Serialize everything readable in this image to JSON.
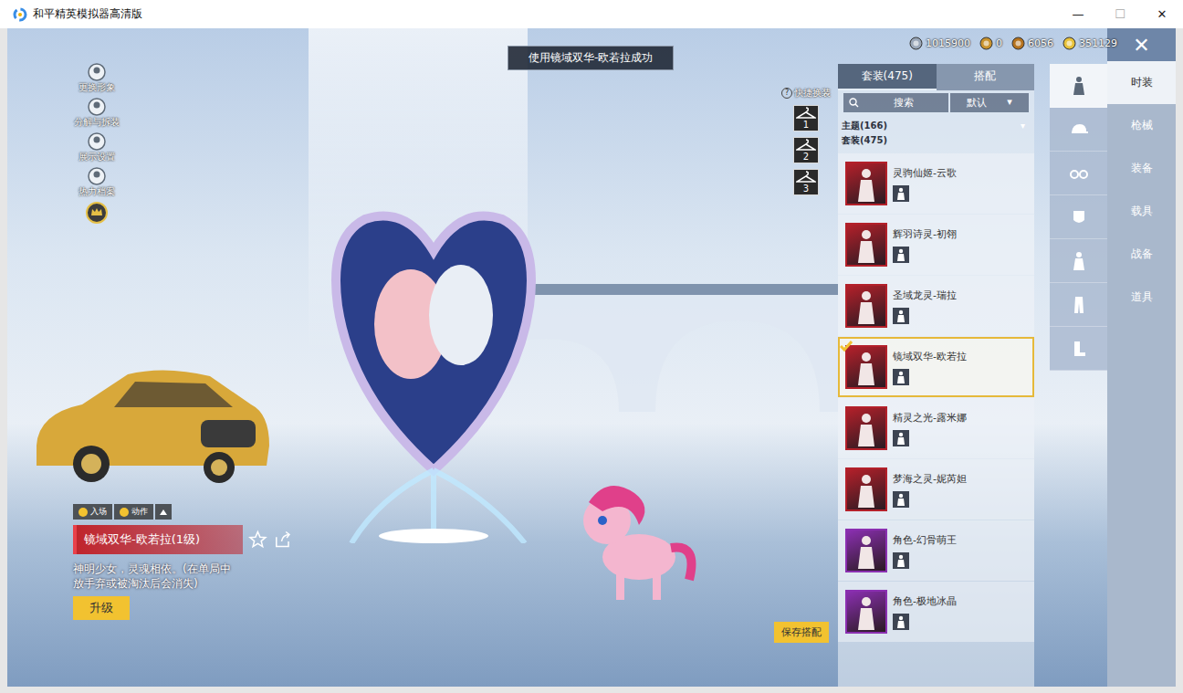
{
  "window": {
    "title": "和平精英模拟器高清版",
    "controls": [
      "—",
      "☐",
      "✕"
    ]
  },
  "toast": "使用镜域双华-欧若拉成功",
  "currencies": [
    {
      "amount": "1015900",
      "color": "#9aa7b8"
    },
    {
      "amount": "0",
      "color": "#c9932e"
    },
    {
      "amount": "6056",
      "color": "#b5731f"
    },
    {
      "amount": "351129",
      "color": "#e8c23a"
    }
  ],
  "close_button": "✕",
  "left_menu": [
    {
      "label": "更换形象"
    },
    {
      "label": "分解与拆装"
    },
    {
      "label": "展示设置"
    },
    {
      "label": "热力档案"
    }
  ],
  "quick_change": {
    "label": "快捷换装",
    "help": "?",
    "slots": [
      "1",
      "2",
      "3"
    ]
  },
  "panel": {
    "tabs": [
      {
        "label": "套装(475)",
        "selected": true
      },
      {
        "label": "搭配",
        "selected": false
      }
    ],
    "search": {
      "placeholder": "搜索"
    },
    "sort": {
      "value": "默认",
      "arrow": "▾"
    },
    "filters": [
      {
        "label": "主题(166)",
        "arrow": "▾"
      },
      {
        "label": "套装(475)",
        "arrow": ""
      }
    ],
    "items": [
      {
        "name": "灵驹仙姬-云歌",
        "selected": false,
        "color": "#b3202a"
      },
      {
        "name": "辉羽诗灵-初翎",
        "selected": false,
        "color": "#b3202a"
      },
      {
        "name": "圣域龙灵-瑞拉",
        "selected": false,
        "color": "#b3202a"
      },
      {
        "name": "镜域双华-欧若拉",
        "selected": true,
        "color": "#b3202a"
      },
      {
        "name": "精灵之光-露米娜",
        "selected": false,
        "color": "#b3202a"
      },
      {
        "name": "梦海之灵-妮芮妲",
        "selected": false,
        "color": "#b3202a"
      },
      {
        "name": "角色-幻骨萌王",
        "selected": false,
        "color": "#8a2fb0"
      },
      {
        "name": "角色-极地冰晶",
        "selected": false,
        "color": "#8a2fb0"
      }
    ]
  },
  "categories": [
    {
      "selected": true
    },
    {
      "selected": false
    },
    {
      "selected": false
    },
    {
      "selected": false
    },
    {
      "selected": false
    },
    {
      "selected": false
    },
    {
      "selected": false
    }
  ],
  "menu": [
    {
      "label": "时装",
      "selected": true
    },
    {
      "label": "枪械",
      "selected": false
    },
    {
      "label": "装备",
      "selected": false
    },
    {
      "label": "载具",
      "selected": false
    },
    {
      "label": "战备",
      "selected": false
    },
    {
      "label": "道具",
      "selected": false
    }
  ],
  "item_info": {
    "actions": [
      {
        "label": "入场"
      },
      {
        "label": "动作"
      }
    ],
    "title": "镜域双华-欧若拉(1级)",
    "description": "神明少女，灵魂相依。(在单局中放手弃或被淘汰后会消失)",
    "upgrade": "升级"
  },
  "save_button": "保存搭配"
}
